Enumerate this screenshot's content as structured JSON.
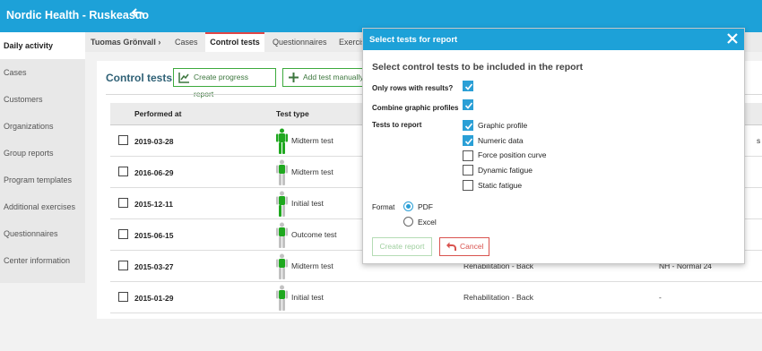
{
  "app": {
    "title": "Nordic Health - Ruskeasuo"
  },
  "sidebar": {
    "items": [
      {
        "label": "Daily activity",
        "active": true
      },
      {
        "label": "Cases"
      },
      {
        "label": "Customers"
      },
      {
        "label": "Organizations"
      },
      {
        "label": "Group reports"
      },
      {
        "label": "Program templates"
      },
      {
        "label": "Additional exercises"
      },
      {
        "label": "Questionnaires"
      },
      {
        "label": "Center information"
      }
    ]
  },
  "breadcrumb": {
    "person": "Tuomas Grönvall",
    "tabs": [
      "Cases",
      "Control tests",
      "Questionnaires",
      "Exercis"
    ]
  },
  "main": {
    "title": "Control tests",
    "create_progress_report": "Create progress report",
    "add_test_manually": "Add test manually",
    "columns": {
      "performed_at": "Performed at",
      "test_type": "Test type"
    },
    "rows": [
      {
        "date": "2019-03-28",
        "type": "Midterm test",
        "category": "",
        "reference": "s"
      },
      {
        "date": "2016-06-29",
        "type": "Midterm test",
        "category": "",
        "reference": ""
      },
      {
        "date": "2015-12-11",
        "type": "Initial test",
        "category": "",
        "reference": ""
      },
      {
        "date": "2015-06-15",
        "type": "Outcome test",
        "category": "",
        "reference": ""
      },
      {
        "date": "2015-03-27",
        "type": "Midterm test",
        "category": "Rehabilitation - Back",
        "reference": "NH - Normal 24"
      },
      {
        "date": "2015-01-29",
        "type": "Initial test",
        "category": "Rehabilitation - Back",
        "reference": "-"
      }
    ]
  },
  "dialog": {
    "title": "Select tests for report",
    "subtitle": "Select control tests to be included in the report",
    "only_rows_label": "Only rows with results?",
    "only_rows_checked": true,
    "combine_label": "Combine graphic profiles",
    "combine_checked": true,
    "tests_label": "Tests to report",
    "tests": [
      {
        "label": "Graphic profile",
        "checked": true
      },
      {
        "label": "Numeric data",
        "checked": true
      },
      {
        "label": "Force position curve",
        "checked": false
      },
      {
        "label": "Dynamic fatigue",
        "checked": false
      },
      {
        "label": "Static fatigue",
        "checked": false
      }
    ],
    "format_label": "Format",
    "formats": [
      {
        "label": "PDF",
        "selected": true
      },
      {
        "label": "Excel",
        "selected": false
      }
    ],
    "create_label": "Create report",
    "cancel_label": "Cancel"
  },
  "colors": {
    "brand": "#1da1d8",
    "green": "#3daa3d",
    "red": "#d9534f",
    "figure_green": "#1fa81f",
    "figure_gray": "#c2c2c2"
  },
  "icons": {
    "back": "undo-arrow-icon",
    "close": "close-icon",
    "chart": "line-chart-icon",
    "plus": "plus-icon",
    "person": "person-figure-icon"
  }
}
